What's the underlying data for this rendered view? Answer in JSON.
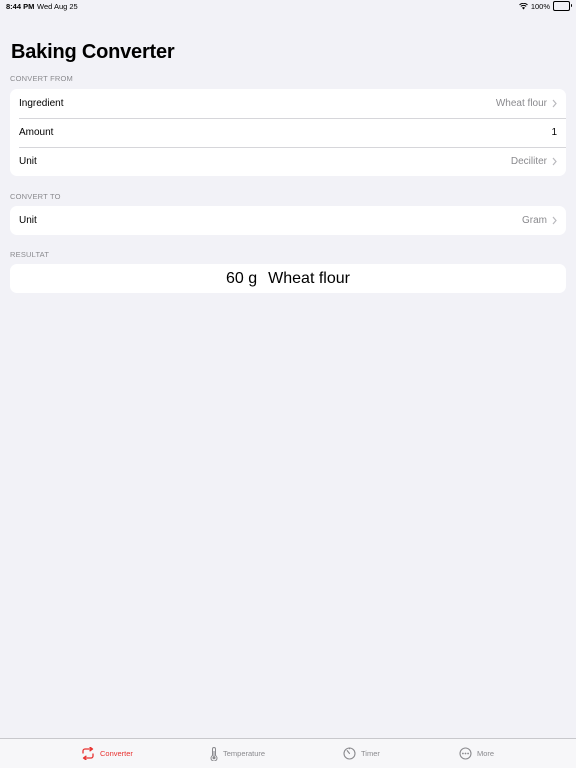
{
  "status": {
    "time": "8:44 PM",
    "date": "Wed Aug 25",
    "battery": "100%"
  },
  "title": "Baking Converter",
  "convert_from": {
    "header": "CONVERT FROM",
    "rows": [
      {
        "label": "Ingredient",
        "value": "Wheat flour"
      },
      {
        "label": "Amount",
        "value": "1"
      },
      {
        "label": "Unit",
        "value": "Deciliter"
      }
    ]
  },
  "convert_to": {
    "header": "CONVERT TO",
    "rows": [
      {
        "label": "Unit",
        "value": "Gram"
      }
    ]
  },
  "result": {
    "header": "RESULTAT",
    "amount": "60 g",
    "ingredient": "Wheat flour"
  },
  "tabs": [
    {
      "label": "Converter",
      "icon": "converter-icon",
      "active": true
    },
    {
      "label": "Temperature",
      "icon": "thermometer-icon",
      "active": false
    },
    {
      "label": "Timer",
      "icon": "timer-icon",
      "active": false
    },
    {
      "label": "More",
      "icon": "more-icon",
      "active": false
    }
  ],
  "colors": {
    "accent": "#e8312f",
    "background": "#f2f2f7",
    "secondary_text": "#8a8a8e"
  }
}
